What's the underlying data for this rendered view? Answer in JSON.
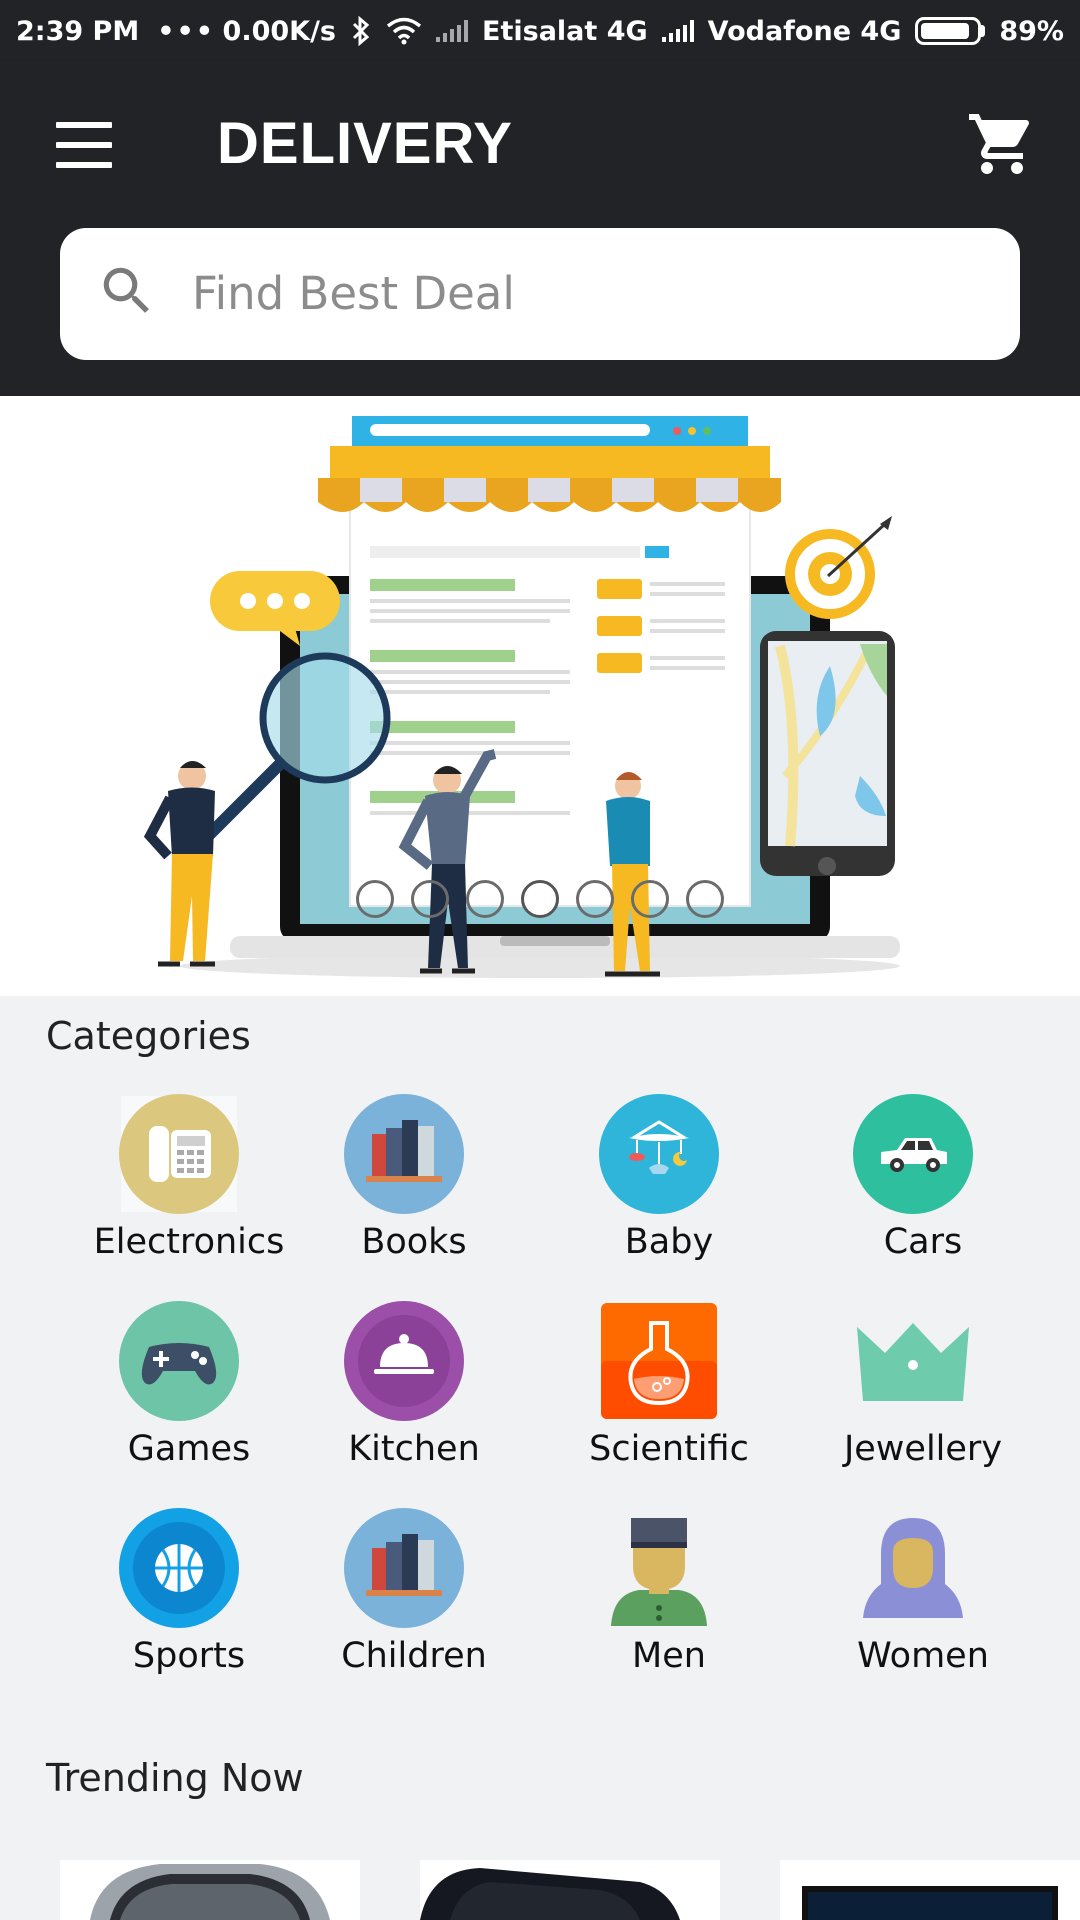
{
  "status_bar": {
    "time": "2:39 PM",
    "dots": "•••",
    "speed": "0.00K/s",
    "carrier1": "Etisalat 4G",
    "carrier2": "Vodafone 4G",
    "battery": "89%",
    "battery_level": 0.89
  },
  "app_bar": {
    "title": "DELIVERY",
    "menu_icon": "menu-icon",
    "cart_icon": "cart-icon"
  },
  "search": {
    "placeholder": "Find Best Deal",
    "icon": "search-icon"
  },
  "banner": {
    "dots_count": 7,
    "active_dot": 3
  },
  "categories": {
    "title": "Categories",
    "items": [
      {
        "label": "Electronics",
        "icon": "telephone-icon"
      },
      {
        "label": "Books",
        "icon": "books-icon"
      },
      {
        "label": "Baby",
        "icon": "baby-mobile-icon"
      },
      {
        "label": "Cars",
        "icon": "car-icon"
      },
      {
        "label": "Games",
        "icon": "gamepad-icon"
      },
      {
        "label": "Kitchen",
        "icon": "cloche-icon"
      },
      {
        "label": "Scientific",
        "icon": "flask-icon"
      },
      {
        "label": "Jewellery",
        "icon": "crown-icon"
      },
      {
        "label": "Sports",
        "icon": "basketball-icon"
      },
      {
        "label": "Children",
        "icon": "books-icon"
      },
      {
        "label": "Men",
        "icon": "man-avatar-icon"
      },
      {
        "label": "Women",
        "icon": "woman-avatar-icon"
      }
    ]
  },
  "trending": {
    "title": "Trending Now",
    "items": [
      {
        "icon": "watch-image"
      },
      {
        "icon": "shoe-image"
      },
      {
        "icon": "laptop-image"
      }
    ]
  }
}
